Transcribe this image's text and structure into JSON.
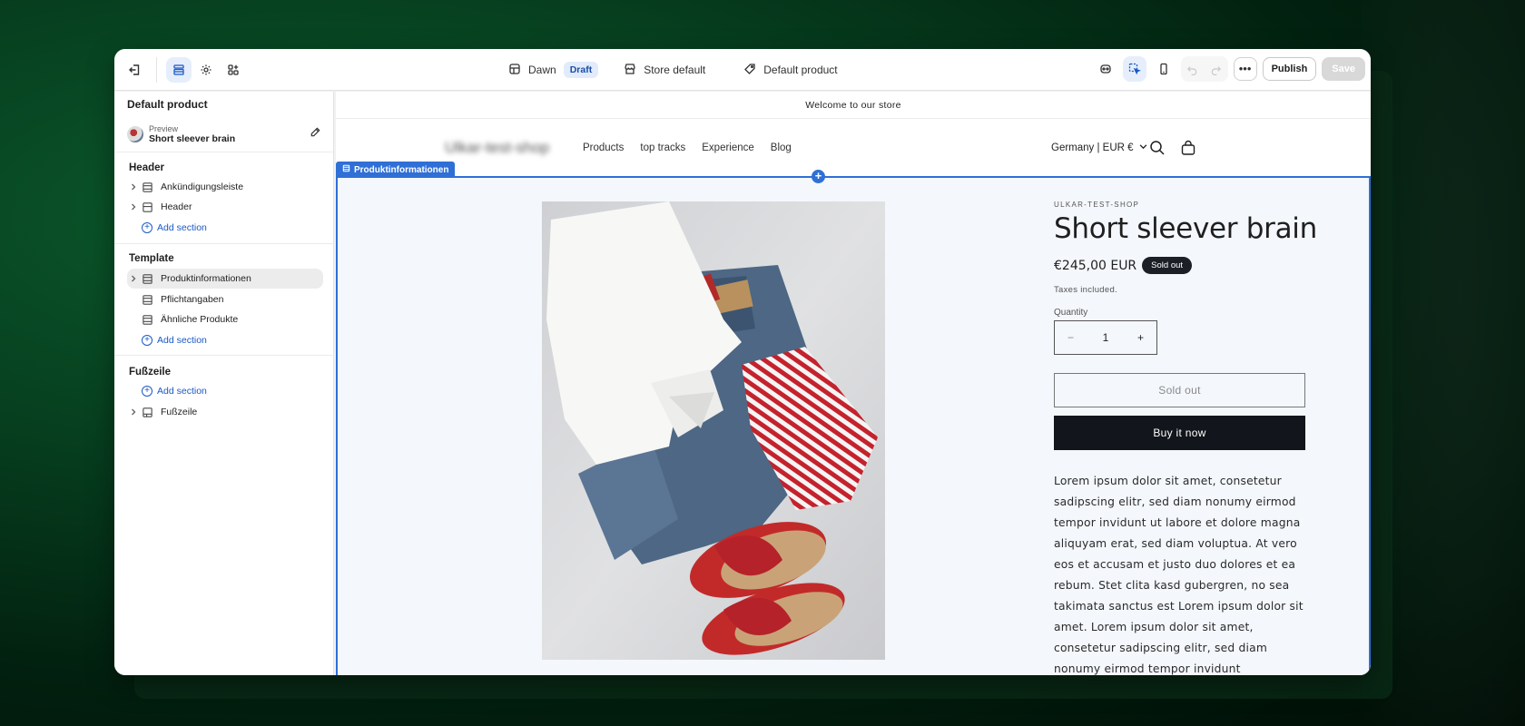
{
  "topbar": {
    "theme_name": "Dawn",
    "theme_status": "Draft",
    "store_context": "Store default",
    "template_name": "Default product",
    "publish_label": "Publish",
    "save_label": "Save"
  },
  "sidebar": {
    "title": "Default product",
    "preview": {
      "label": "Preview",
      "value": "Short sleever brain"
    },
    "groups": [
      {
        "title": "Header",
        "items": [
          {
            "label": "Ankündigungsleiste"
          },
          {
            "label": "Header"
          }
        ],
        "add_label": "Add section"
      },
      {
        "title": "Template",
        "items": [
          {
            "label": "Produktinformationen"
          },
          {
            "label": "Pflichtangaben"
          },
          {
            "label": "Ähnliche Produkte"
          }
        ],
        "add_label": "Add section"
      },
      {
        "title": "Fußzeile",
        "add_label": "Add section",
        "items": [
          {
            "label": "Fußzeile"
          }
        ]
      }
    ]
  },
  "store": {
    "announcement": "Welcome to our store",
    "logo": "Ulkar-test-shop",
    "nav": [
      "Products",
      "top tracks",
      "Experience",
      "Blog"
    ],
    "localization": "Germany | EUR €"
  },
  "section_tag": "Produktinformationen",
  "product": {
    "vendor": "ULKAR-TEST-SHOP",
    "title": "Short sleever brain",
    "price": "€245,00 EUR",
    "badge": "Sold out",
    "taxes": "Taxes included.",
    "quantity_label": "Quantity",
    "quantity_value": "1",
    "soldout_button": "Sold out",
    "buy_button": "Buy it now",
    "description": "Lorem ipsum dolor sit amet, consetetur sadipscing elitr, sed diam nonumy eirmod tempor invidunt ut labore et dolore magna aliquyam erat, sed diam voluptua. At vero eos et accusam et justo duo dolores et ea rebum. Stet clita kasd gubergren, no sea takimata sanctus est Lorem ipsum dolor sit amet. Lorem ipsum dolor sit amet, consetetur sadipscing elitr, sed diam nonumy eirmod tempor invidunt"
  },
  "colors": {
    "accent": "#2f6fd6",
    "link": "#1a59c6",
    "buy_button": "#12151b",
    "background_green": "#063d1e"
  }
}
